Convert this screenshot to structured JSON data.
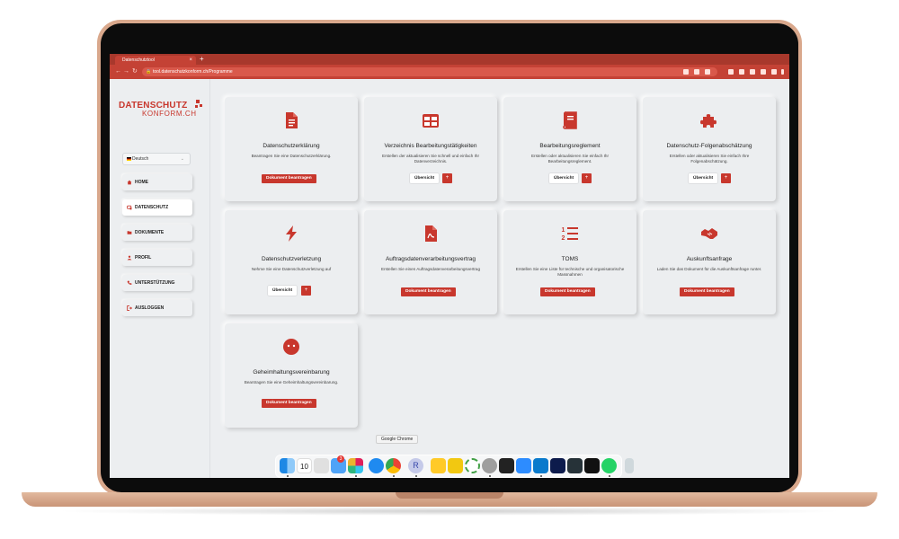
{
  "browser": {
    "tab_title": "Datenschutztool",
    "tab_close": "×",
    "new_tab": "+",
    "back": "←",
    "forward": "→",
    "reload": "↻",
    "url": "tool.datenschutzkonform.ch/Programme"
  },
  "logo": {
    "top": "DATENSCHUTZ",
    "bottom": "KONFORM.CH"
  },
  "sidebar": {
    "language": "Deutsch",
    "items": [
      {
        "label": "HOME",
        "icon": "home-icon"
      },
      {
        "label": "DATENSCHUTZ",
        "icon": "shield-icon"
      },
      {
        "label": "DOKUMENTE",
        "icon": "folder-icon"
      },
      {
        "label": "PROFIL",
        "icon": "user-icon"
      },
      {
        "label": "UNTERSTÜTZUNG",
        "icon": "phone-icon"
      },
      {
        "label": "AUSLOGGEN",
        "icon": "logout-icon"
      }
    ]
  },
  "cards": [
    {
      "title": "Datenschutzerklärung",
      "desc": "Beantragen Sie eine Datenschutzerklärung.",
      "button": "Dokument beantragen",
      "icon": "document-icon"
    },
    {
      "title": "Verzeichnis Bearbeitungstätigkeiten",
      "desc": "Erstellen der aktualisieren Sie schnell und einfach Ihr Datenverzeichnis.",
      "overview": "Übersicht",
      "plus": "+",
      "icon": "table-icon"
    },
    {
      "title": "Bearbeitungsreglement",
      "desc": "Erstellen oder aktualisieren Sie einfach Ihr Bearbeitungsreglement.",
      "overview": "Übersicht",
      "plus": "+",
      "icon": "book-icon"
    },
    {
      "title": "Datenschutz-Folgenabschätzung",
      "desc": "Erstellen oder aktualisieren Sie einfach Ihre Folgenabschätzung.",
      "overview": "Übersicht",
      "plus": "+",
      "icon": "puzzle-icon"
    },
    {
      "title": "Datenschutzverletzung",
      "desc": "Nehme Sie eine Datenschutzverletzung auf",
      "overview": "Übersicht",
      "plus": "+",
      "icon": "bolt-icon"
    },
    {
      "title": "Auftragsdatenverarbeitungsvertrag",
      "desc": "Erstellen Sie einen Auftragsdatenverarbeitungsvertrag",
      "button": "Dokument beantragen",
      "icon": "pdf-icon"
    },
    {
      "title": "TOMS",
      "desc": "Erstellen Sie eine Liste für technische und organisatorische Massnahmen",
      "button": "Dokument beantragen",
      "icon": "numbered-list-icon"
    },
    {
      "title": "Auskunftsanfrage",
      "desc": "Laden Sie das Dokument für die Auskunftsanfrage runter.",
      "button": "Dokument beantragen",
      "icon": "handshake-icon"
    },
    {
      "title": "Geheimhaltungsvereinbarung",
      "desc": "Beantragen Sie eine Geheimhaltungsvereinbarung.",
      "button": "Dokument beantragen",
      "icon": "silent-face-icon"
    }
  ],
  "dock": {
    "tooltip": "Google Chrome",
    "calendar_day": "10",
    "apps": [
      "finder",
      "calendar",
      "launchpad",
      "mail",
      "slack",
      "safari",
      "chrome",
      "r-app",
      "sheets",
      "powerbi",
      "activity",
      "settings",
      "dark-app",
      "zoom",
      "vscode",
      "tool-1",
      "tool-2",
      "tool-3",
      "whatsapp",
      "trash"
    ],
    "badge": "3"
  },
  "colors": {
    "accent": "#c8372d",
    "chrome": "#c44235",
    "background": "#eceef0"
  }
}
